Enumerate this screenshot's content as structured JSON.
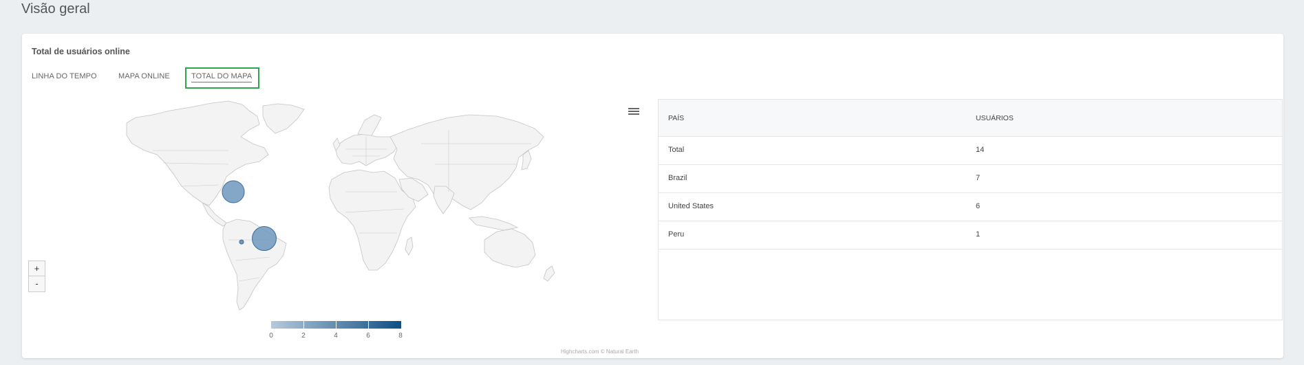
{
  "page": {
    "title": "Visão geral"
  },
  "card": {
    "title": "Total de usuários online",
    "tabs": [
      {
        "label": "LINHA DO TEMPO",
        "active": false
      },
      {
        "label": "MAPA ONLINE",
        "active": false
      },
      {
        "label": "TOTAL DO MAPA",
        "active": true
      }
    ]
  },
  "map": {
    "menu_icon": "hamburger-menu-icon",
    "zoom_in_label": "+",
    "zoom_out_label": "-",
    "bubble_color": "#6f98bd",
    "land_color": "#f3f3f3",
    "border_color": "#c4c4c4",
    "legend": {
      "ticks": [
        "0",
        "2",
        "4",
        "6",
        "8"
      ],
      "min_color": "#b6c9db",
      "max_color": "#0f5085"
    },
    "credits": "Highcharts.com © Natural Earth"
  },
  "table": {
    "headers": [
      "PAÍS",
      "USUÁRIOS"
    ],
    "rows": [
      {
        "country": "Total",
        "users": "14"
      },
      {
        "country": "Brazil",
        "users": "7"
      },
      {
        "country": "United States",
        "users": "6"
      },
      {
        "country": "Peru",
        "users": "1"
      }
    ]
  },
  "colors": {
    "highlight_border": "#2ea44f",
    "background": "#eceff1"
  }
}
